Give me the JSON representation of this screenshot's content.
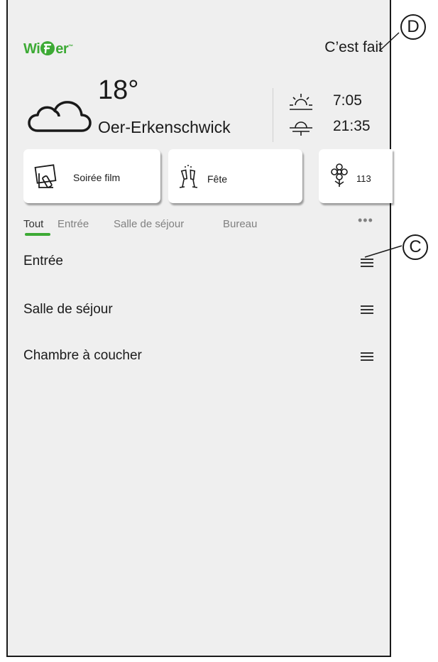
{
  "header": {
    "logo_text": "Wiser",
    "logo_tm": "™",
    "done_label": "C’est fait"
  },
  "weather": {
    "icon": "cloud-icon",
    "temperature": "18°",
    "city": "Oer-Erkenschwick",
    "sunrise": "7:05",
    "sunset": "21:35"
  },
  "moments": [
    {
      "label": "Soirée film",
      "icon": "movie-remote-icon"
    },
    {
      "label": "Fête",
      "icon": "champagne-glasses-icon"
    },
    {
      "label": "113",
      "icon": "flower-icon"
    }
  ],
  "tabs": [
    {
      "label": "Tout",
      "active": true
    },
    {
      "label": "Entrée"
    },
    {
      "label": "Salle de séjour"
    },
    {
      "label": "Bureau"
    }
  ],
  "more_label": "•••",
  "rooms": [
    "Entrée",
    "Salle de séjour",
    "Chambre à coucher"
  ],
  "callouts": {
    "c": "C",
    "d": "D"
  },
  "colors": {
    "accent": "#3daa35",
    "background": "#efefef",
    "card": "#ffffff"
  }
}
